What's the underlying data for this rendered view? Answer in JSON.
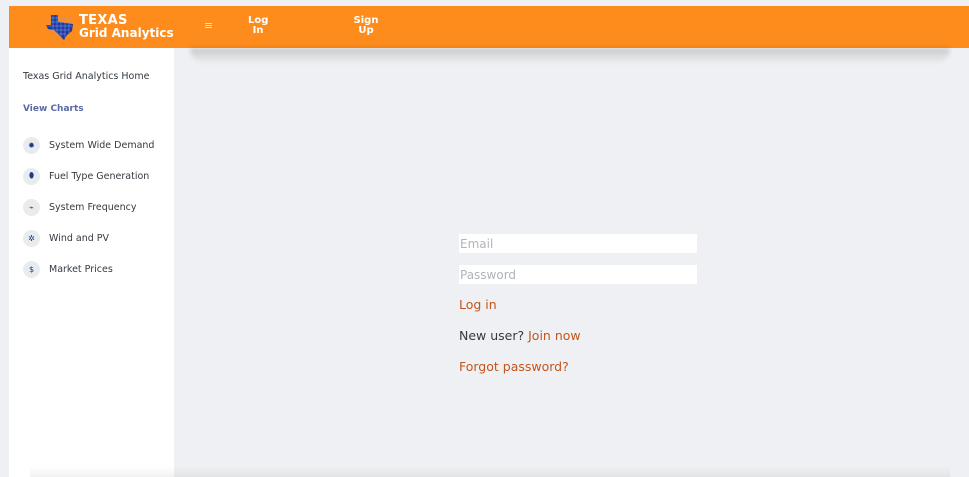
{
  "brand": {
    "line1": "TEXAS",
    "line2": "Grid Analytics",
    "logo_icon": "texas-grid-logo-icon"
  },
  "topnav": {
    "menu_icon": "≡",
    "login": [
      "Log",
      "In"
    ],
    "signup": [
      "Sign",
      "Up"
    ]
  },
  "sidebar": {
    "home": "Texas Grid Analytics Home",
    "section": "View Charts",
    "items": [
      {
        "label": "System Wide Demand",
        "icon": "lightbulb-icon",
        "glyph": "✹"
      },
      {
        "label": "Fuel Type Generation",
        "icon": "fuel-drop-icon",
        "glyph": "⬮"
      },
      {
        "label": "System Frequency",
        "icon": "frequency-wave-icon",
        "glyph": "⌁"
      },
      {
        "label": "Wind and PV",
        "icon": "snowflake-icon",
        "glyph": "✲"
      },
      {
        "label": "Market Prices",
        "icon": "dollar-icon",
        "glyph": "$"
      }
    ]
  },
  "form": {
    "email_placeholder": "Email",
    "password_placeholder": "Password",
    "login_label": "Log in",
    "newuser_text": "New user? ",
    "join_label": "Join now",
    "forgot_label": "Forgot password?"
  },
  "colors": {
    "accent": "#fd8c1c",
    "link": "#c2561c",
    "background": "#eff0f3"
  }
}
